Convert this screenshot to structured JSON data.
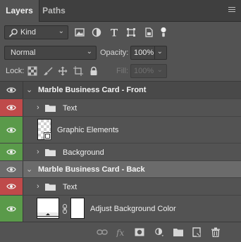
{
  "tabs": {
    "layers": "Layers",
    "paths": "Paths"
  },
  "filter": {
    "kind_label": "Kind"
  },
  "blend": {
    "mode": "Normal",
    "opacity_label": "Opacity:",
    "opacity_value": "100%"
  },
  "lock": {
    "label": "Lock:",
    "fill_label": "Fill:",
    "fill_value": "100%"
  },
  "layers": [
    {
      "name": "Marble Business Card - Front",
      "type": "group",
      "expanded": true,
      "eye_color": "none"
    },
    {
      "name": "Text",
      "type": "group",
      "expanded": false,
      "eye_color": "red"
    },
    {
      "name": "Graphic Elements",
      "type": "layer",
      "eye_color": "green"
    },
    {
      "name": "Background",
      "type": "group",
      "expanded": false,
      "eye_color": "green"
    },
    {
      "name": "Marble Business Card - Back",
      "type": "group",
      "expanded": true,
      "eye_color": "none",
      "selected": true
    },
    {
      "name": "Text",
      "type": "group",
      "expanded": false,
      "eye_color": "red"
    },
    {
      "name": "Adjust Background Color",
      "type": "layer",
      "eye_color": "green"
    }
  ],
  "colors": {
    "red_label": "#bf4a4a",
    "green_label": "#5a9a4a",
    "panel_bg": "#535353"
  },
  "bottom_icons": [
    "link-icon",
    "fx-icon",
    "mask-icon",
    "adjustment-icon",
    "folder-icon",
    "new-layer-icon",
    "trash-icon"
  ]
}
